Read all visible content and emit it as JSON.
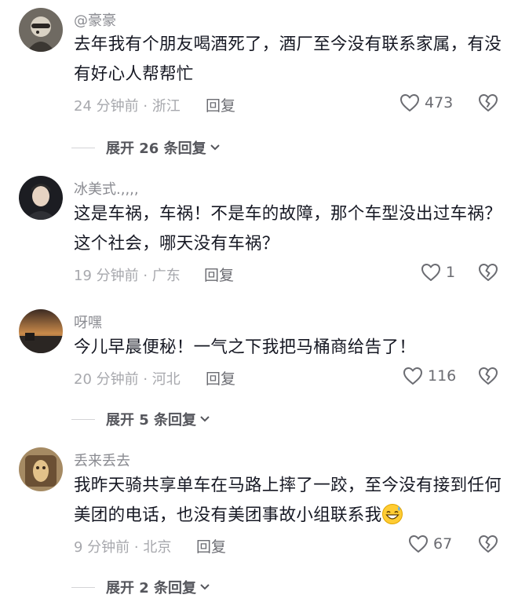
{
  "comments": [
    {
      "username": "@豪豪",
      "text": "去年我有个朋友喝酒死了，酒厂至今没有联系家属，有没有好心人帮帮忙",
      "time_location": "24 分钟前 · 浙江",
      "reply_label": "回复",
      "likes": "473",
      "expand_label": "展开 26 条回复"
    },
    {
      "username": "冰美式.,,,,",
      "text": "这是车祸，车祸！不是车的故障，那个车型没出过车祸？这个社会，哪天没有车祸？",
      "time_location": "19 分钟前 · 广东",
      "reply_label": "回复",
      "likes": "1"
    },
    {
      "username": "呀嘿",
      "text": "今儿早晨便秘！一气之下我把马桶商给告了！",
      "time_location": "20 分钟前 · 河北",
      "reply_label": "回复",
      "likes": "116",
      "expand_label": "展开 5 条回复"
    },
    {
      "username": "丢来丢去",
      "text": "我昨天骑共享单车在马路上摔了一跤，至今没有接到任何美团的电话，也没有美团事故小组联系我",
      "time_location": "9 分钟前 · 北京",
      "reply_label": "回复",
      "likes": "67",
      "expand_label": "展开 2 条回复"
    }
  ],
  "icons": {
    "like": "heart-outline-icon",
    "dislike": "broken-heart-icon",
    "expand": "chevron-down-icon",
    "emoji": "grinning-sweat-emoji-icon"
  },
  "colors": {
    "text": "#161823",
    "meta": "#a7a8ad",
    "username": "#8a8b91"
  }
}
